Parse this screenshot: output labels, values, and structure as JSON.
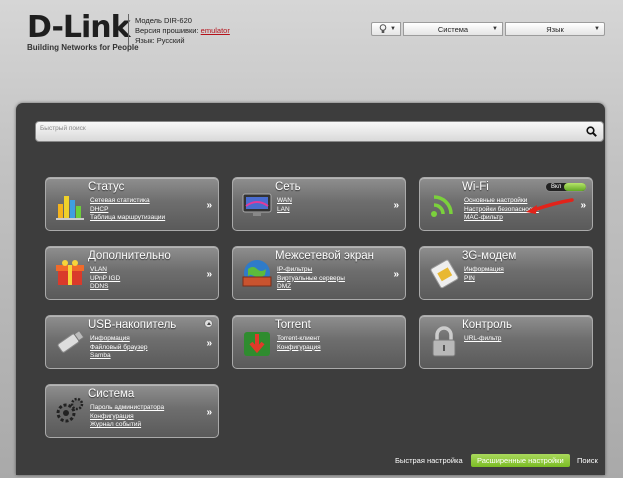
{
  "brand": {
    "logo": "D-Link",
    "tagline": "Building Networks for People"
  },
  "device": {
    "model_line": "Модель DIR-620",
    "firmware_label": "Версия прошивки:",
    "firmware_value": "emulator",
    "language_line": "Язык: Русский"
  },
  "topbar": {
    "system_label": "Система",
    "language_label": "Язык"
  },
  "search": {
    "placeholder": "Быстрый поиск"
  },
  "cards": {
    "status": {
      "title": "Статус",
      "links": [
        "Сетевая статистика",
        "DHCP",
        "Таблица маршрутизации"
      ]
    },
    "network": {
      "title": "Сеть",
      "links": [
        "WAN",
        "LAN"
      ]
    },
    "wifi": {
      "title": "Wi-Fi",
      "toggle_label": "Вкл",
      "links": [
        "Основные настройки",
        "Настройки безопасности",
        "MAC-фильтр"
      ]
    },
    "advanced": {
      "title": "Дополнительно",
      "links": [
        "VLAN",
        "UPnP IGD",
        "DDNS"
      ]
    },
    "firewall": {
      "title": "Межсетевой экран",
      "links": [
        "IP-фильтры",
        "Виртуальные серверы",
        "DMZ"
      ]
    },
    "modem": {
      "title": "3G-модем",
      "links": [
        "Информация",
        "PIN"
      ]
    },
    "usb": {
      "title": "USB-накопитель",
      "links": [
        "Информация",
        "Файловый браузер",
        "Samba"
      ]
    },
    "torrent": {
      "title": "Torrent",
      "links": [
        "Torrent-клиент",
        "Конфигурация"
      ]
    },
    "control": {
      "title": "Контроль",
      "links": [
        "URL-фильтр"
      ]
    },
    "system": {
      "title": "Система",
      "links": [
        "Пароль администратора",
        "Конфигурация",
        "Журнал событий"
      ]
    }
  },
  "footer": {
    "quick": "Быстрая настройка",
    "advanced": "Расширенные настройки",
    "search": "Поиск"
  }
}
